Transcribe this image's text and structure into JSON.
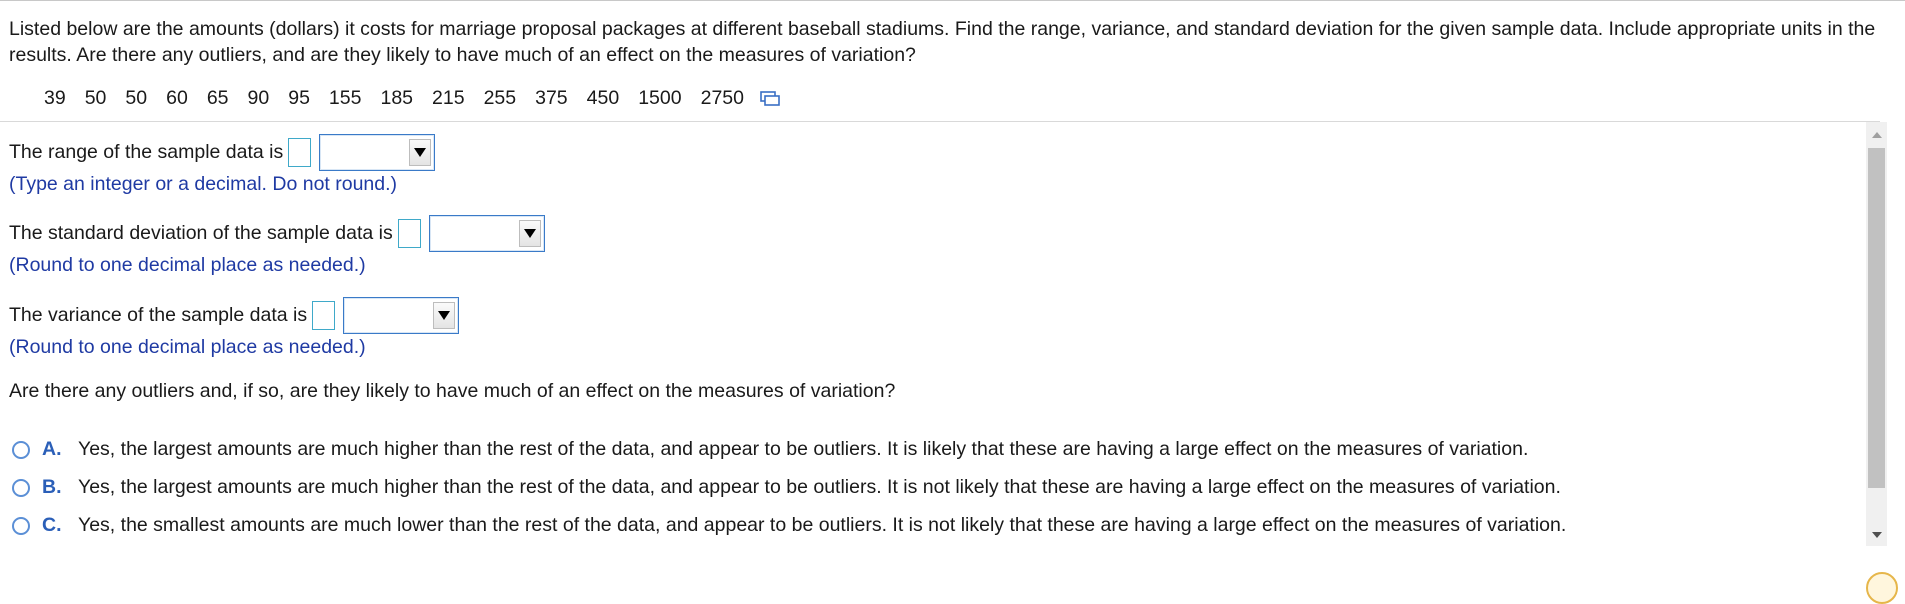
{
  "question": {
    "text": "Listed below are the amounts (dollars) it costs for marriage proposal packages at different baseball stadiums. Find the range, variance, and standard deviation for the given sample data. Include appropriate units in the results. Are there any outliers, and are they likely to have much of an effect on the measures of variation?",
    "data_values": [
      "39",
      "50",
      "50",
      "60",
      "65",
      "90",
      "95",
      "155",
      "185",
      "215",
      "255",
      "375",
      "450",
      "1500",
      "2750"
    ],
    "copy_icon": "copy-data-icon"
  },
  "range_item": {
    "prompt": "The range of the sample data is",
    "input_value": "",
    "unit_selected": "",
    "hint": "(Type an integer or a decimal. Do not round.)"
  },
  "sd_item": {
    "prompt": "The standard deviation of the sample data is",
    "input_value": "",
    "unit_selected": "",
    "hint": "(Round to one decimal place as needed.)"
  },
  "variance_item": {
    "prompt": "The variance of the sample data is",
    "input_value": "",
    "unit_selected": "",
    "hint": "(Round to one decimal place as needed.)"
  },
  "outliers": {
    "question": "Are there any outliers and, if so, are they likely to have much of an effect on the measures of variation?",
    "choices": [
      {
        "letter": "A.",
        "text": "Yes, the largest amounts are much higher than the rest of the data, and appear to be outliers. It is likely that these are having a large effect on the measures of variation."
      },
      {
        "letter": "B.",
        "text": "Yes, the largest amounts are much higher than the rest of the data, and appear to be outliers. It is not likely that these are having a large effect on the measures of variation."
      },
      {
        "letter": "C.",
        "text": "Yes, the smallest amounts are much lower than the rest of the data, and appear to be outliers. It is not likely that these are having a large effect on the measures of variation."
      }
    ]
  },
  "colors": {
    "hint_blue": "#1f3aa3",
    "choice_letter_blue": "#2b5fb8",
    "input_border": "#3fa9c9"
  }
}
